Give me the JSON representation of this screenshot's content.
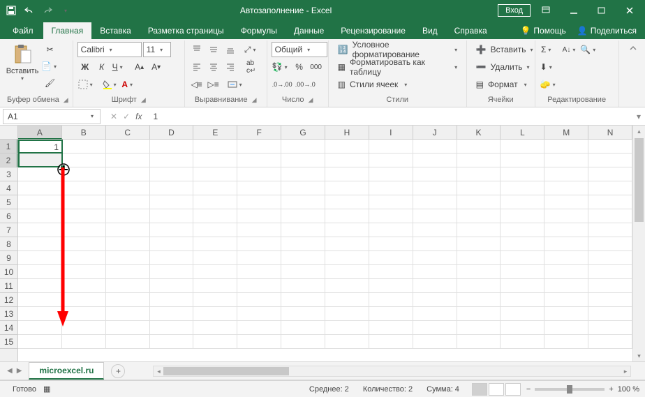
{
  "titlebar": {
    "title": "Автозаполнение  -  Excel",
    "login": "Вход"
  },
  "tabs": {
    "file": "Файл",
    "items": [
      "Главная",
      "Вставка",
      "Разметка страницы",
      "Формулы",
      "Данные",
      "Рецензирование",
      "Вид",
      "Справка"
    ],
    "active": 0,
    "tell_me": "Помощь",
    "share": "Поделиться"
  },
  "ribbon": {
    "clipboard": {
      "paste": "Вставить",
      "label": "Буфер обмена"
    },
    "font": {
      "family": "Calibri",
      "size": "11",
      "bold": "Ж",
      "italic": "К",
      "underline": "Ч",
      "label": "Шрифт"
    },
    "align": {
      "label": "Выравнивание"
    },
    "number": {
      "format": "Общий",
      "label": "Число"
    },
    "styles": {
      "cond": "Условное форматирование",
      "table": "Форматировать как таблицу",
      "cell": "Стили ячеек",
      "label": "Стили"
    },
    "cells": {
      "insert": "Вставить",
      "delete": "Удалить",
      "format": "Формат",
      "label": "Ячейки"
    },
    "editing": {
      "label": "Редактирование"
    }
  },
  "fx": {
    "namebox": "A1",
    "formula": "1"
  },
  "grid": {
    "cols": [
      "A",
      "B",
      "C",
      "D",
      "E",
      "F",
      "G",
      "H",
      "I",
      "J",
      "K",
      "L",
      "M",
      "N"
    ],
    "rows": 15,
    "a1": "1",
    "sel_rows": [
      1,
      2
    ]
  },
  "sheet": {
    "name": "microexcel.ru"
  },
  "status": {
    "ready": "Готово",
    "avg": "Среднее: 2",
    "count": "Количество: 2",
    "sum": "Сумма: 4",
    "zoom": "100 %"
  }
}
